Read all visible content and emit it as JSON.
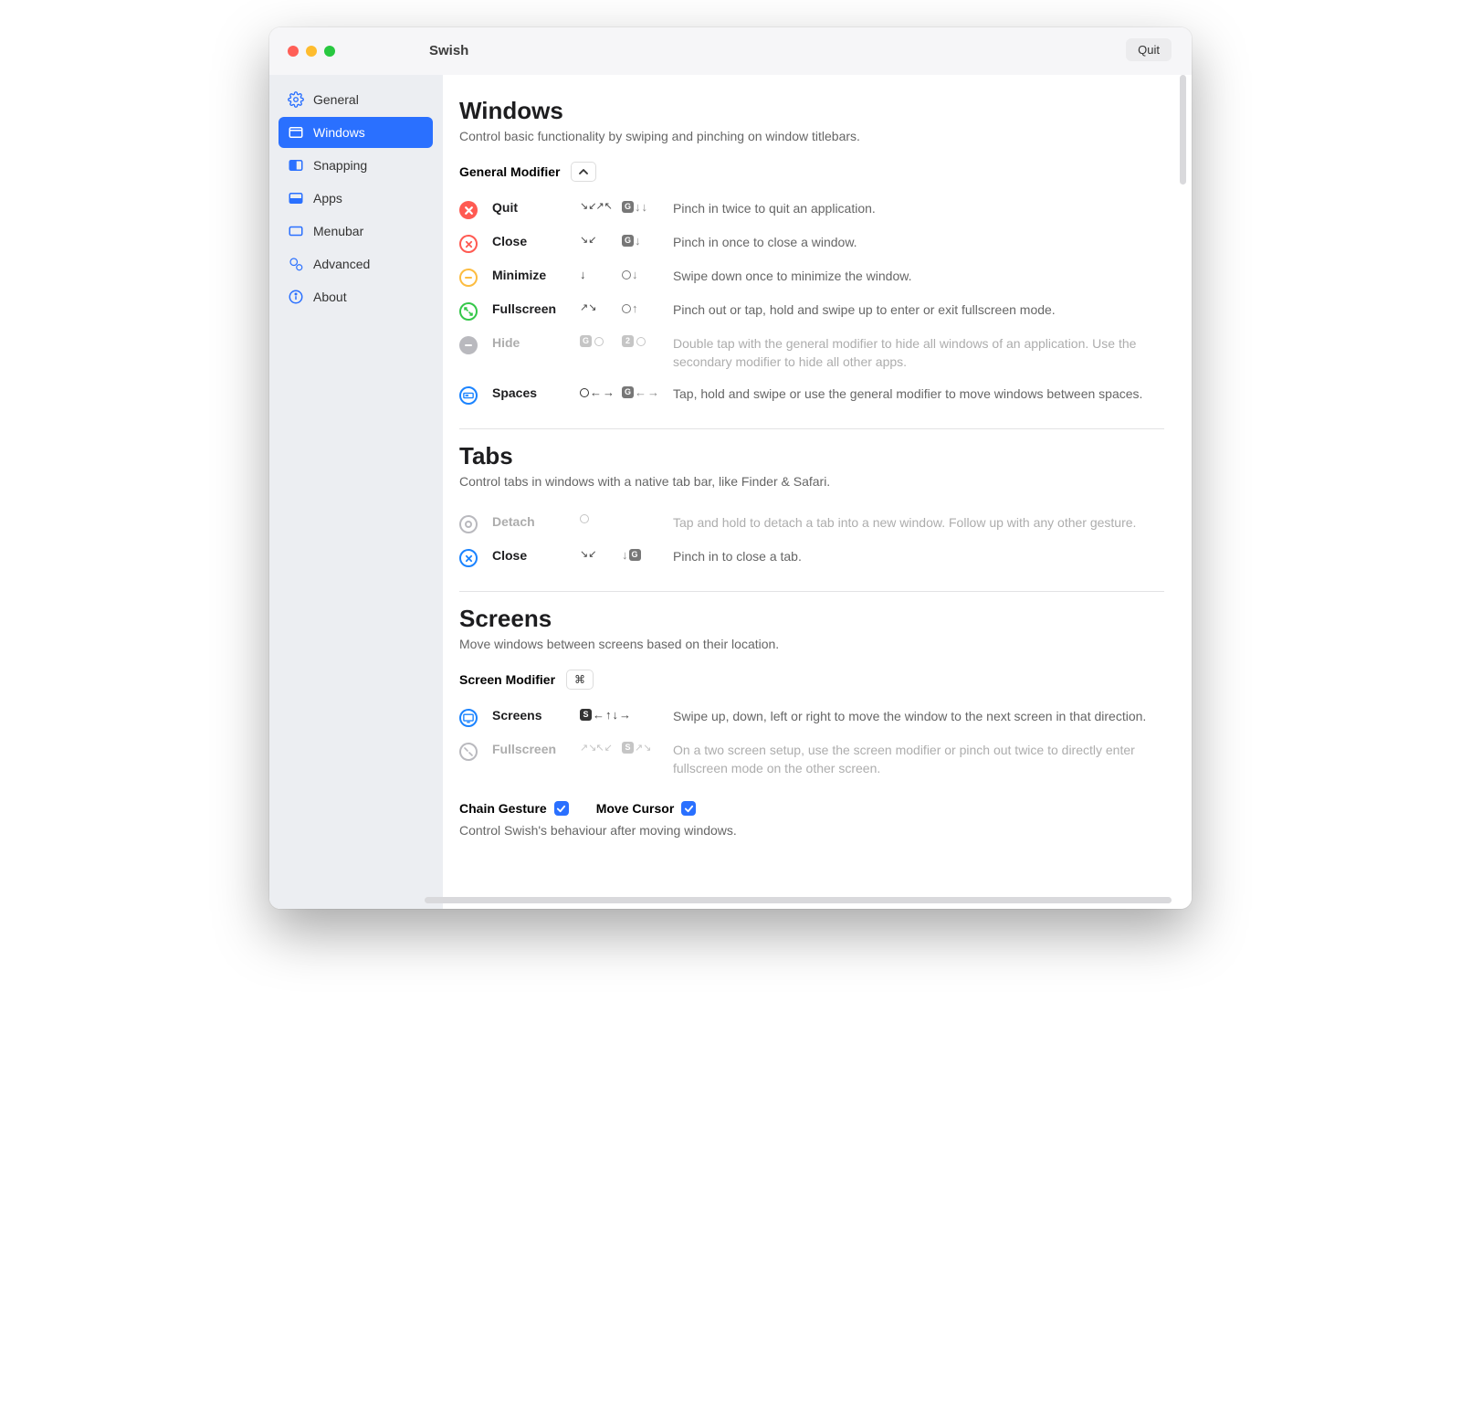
{
  "title": "Swish",
  "quit": "Quit",
  "sidebar": [
    {
      "label": "General",
      "icon": "gear"
    },
    {
      "label": "Windows",
      "icon": "window"
    },
    {
      "label": "Snapping",
      "icon": "snap"
    },
    {
      "label": "Apps",
      "icon": "apps"
    },
    {
      "label": "Menubar",
      "icon": "menubar"
    },
    {
      "label": "Advanced",
      "icon": "gears"
    },
    {
      "label": "About",
      "icon": "info"
    }
  ],
  "sections": {
    "windows": {
      "heading": "Windows",
      "subtitle": "Control basic functionality by swiping and pinching on window titlebars.",
      "modifier_label": "General Modifier",
      "modifier_button": "^",
      "rows": [
        {
          "name": "Quit",
          "desc": "Pinch in twice to quit an application.",
          "icon": "x",
          "color": "#ff5a52"
        },
        {
          "name": "Close",
          "desc": "Pinch in once to close a window.",
          "icon": "x",
          "color": "#ff5a52"
        },
        {
          "name": "Minimize",
          "desc": "Swipe down once to minimize the window.",
          "icon": "minus",
          "color": "#fcbc40"
        },
        {
          "name": "Fullscreen",
          "desc": "Pinch out or tap, hold and swipe up to enter or exit fullscreen mode.",
          "icon": "expand",
          "color": "#34c749"
        },
        {
          "name": "Hide",
          "desc": "Double tap with the general modifier to hide all windows of an application. Use the secondary modifier to hide all other apps.",
          "icon": "minus",
          "color": "#b9b9be",
          "disabled": true
        },
        {
          "name": "Spaces",
          "desc": "Tap, hold and swipe or use the general modifier to move windows between spaces.",
          "icon": "spaces",
          "color": "#1a83ff"
        }
      ]
    },
    "tabs": {
      "heading": "Tabs",
      "subtitle": "Control tabs in windows with a native tab bar, like Finder & Safari.",
      "rows": [
        {
          "name": "Detach",
          "desc": "Tap and hold to detach a tab into a new window. Follow up with any other gesture.",
          "icon": "detach",
          "color": "#b9b9be",
          "disabled": true
        },
        {
          "name": "Close",
          "desc": "Pinch in to close a tab.",
          "icon": "x",
          "color": "#1a83ff"
        }
      ]
    },
    "screens": {
      "heading": "Screens",
      "subtitle": "Move windows between screens based on their location.",
      "modifier_label": "Screen Modifier",
      "modifier_button": "⌘",
      "rows": [
        {
          "name": "Screens",
          "desc": "Swipe up, down, left or right to move the window to the next screen in that direction.",
          "icon": "monitor",
          "color": "#1a83ff"
        },
        {
          "name": "Fullscreen",
          "desc": "On a two screen setup, use the screen modifier or pinch out twice to directly enter fullscreen mode on the other screen.",
          "icon": "expand",
          "color": "#b9b9be",
          "disabled": true
        }
      ],
      "chain_label": "Chain Gesture",
      "cursor_label": "Move Cursor",
      "footer": "Control Swish's behaviour after moving windows."
    }
  }
}
